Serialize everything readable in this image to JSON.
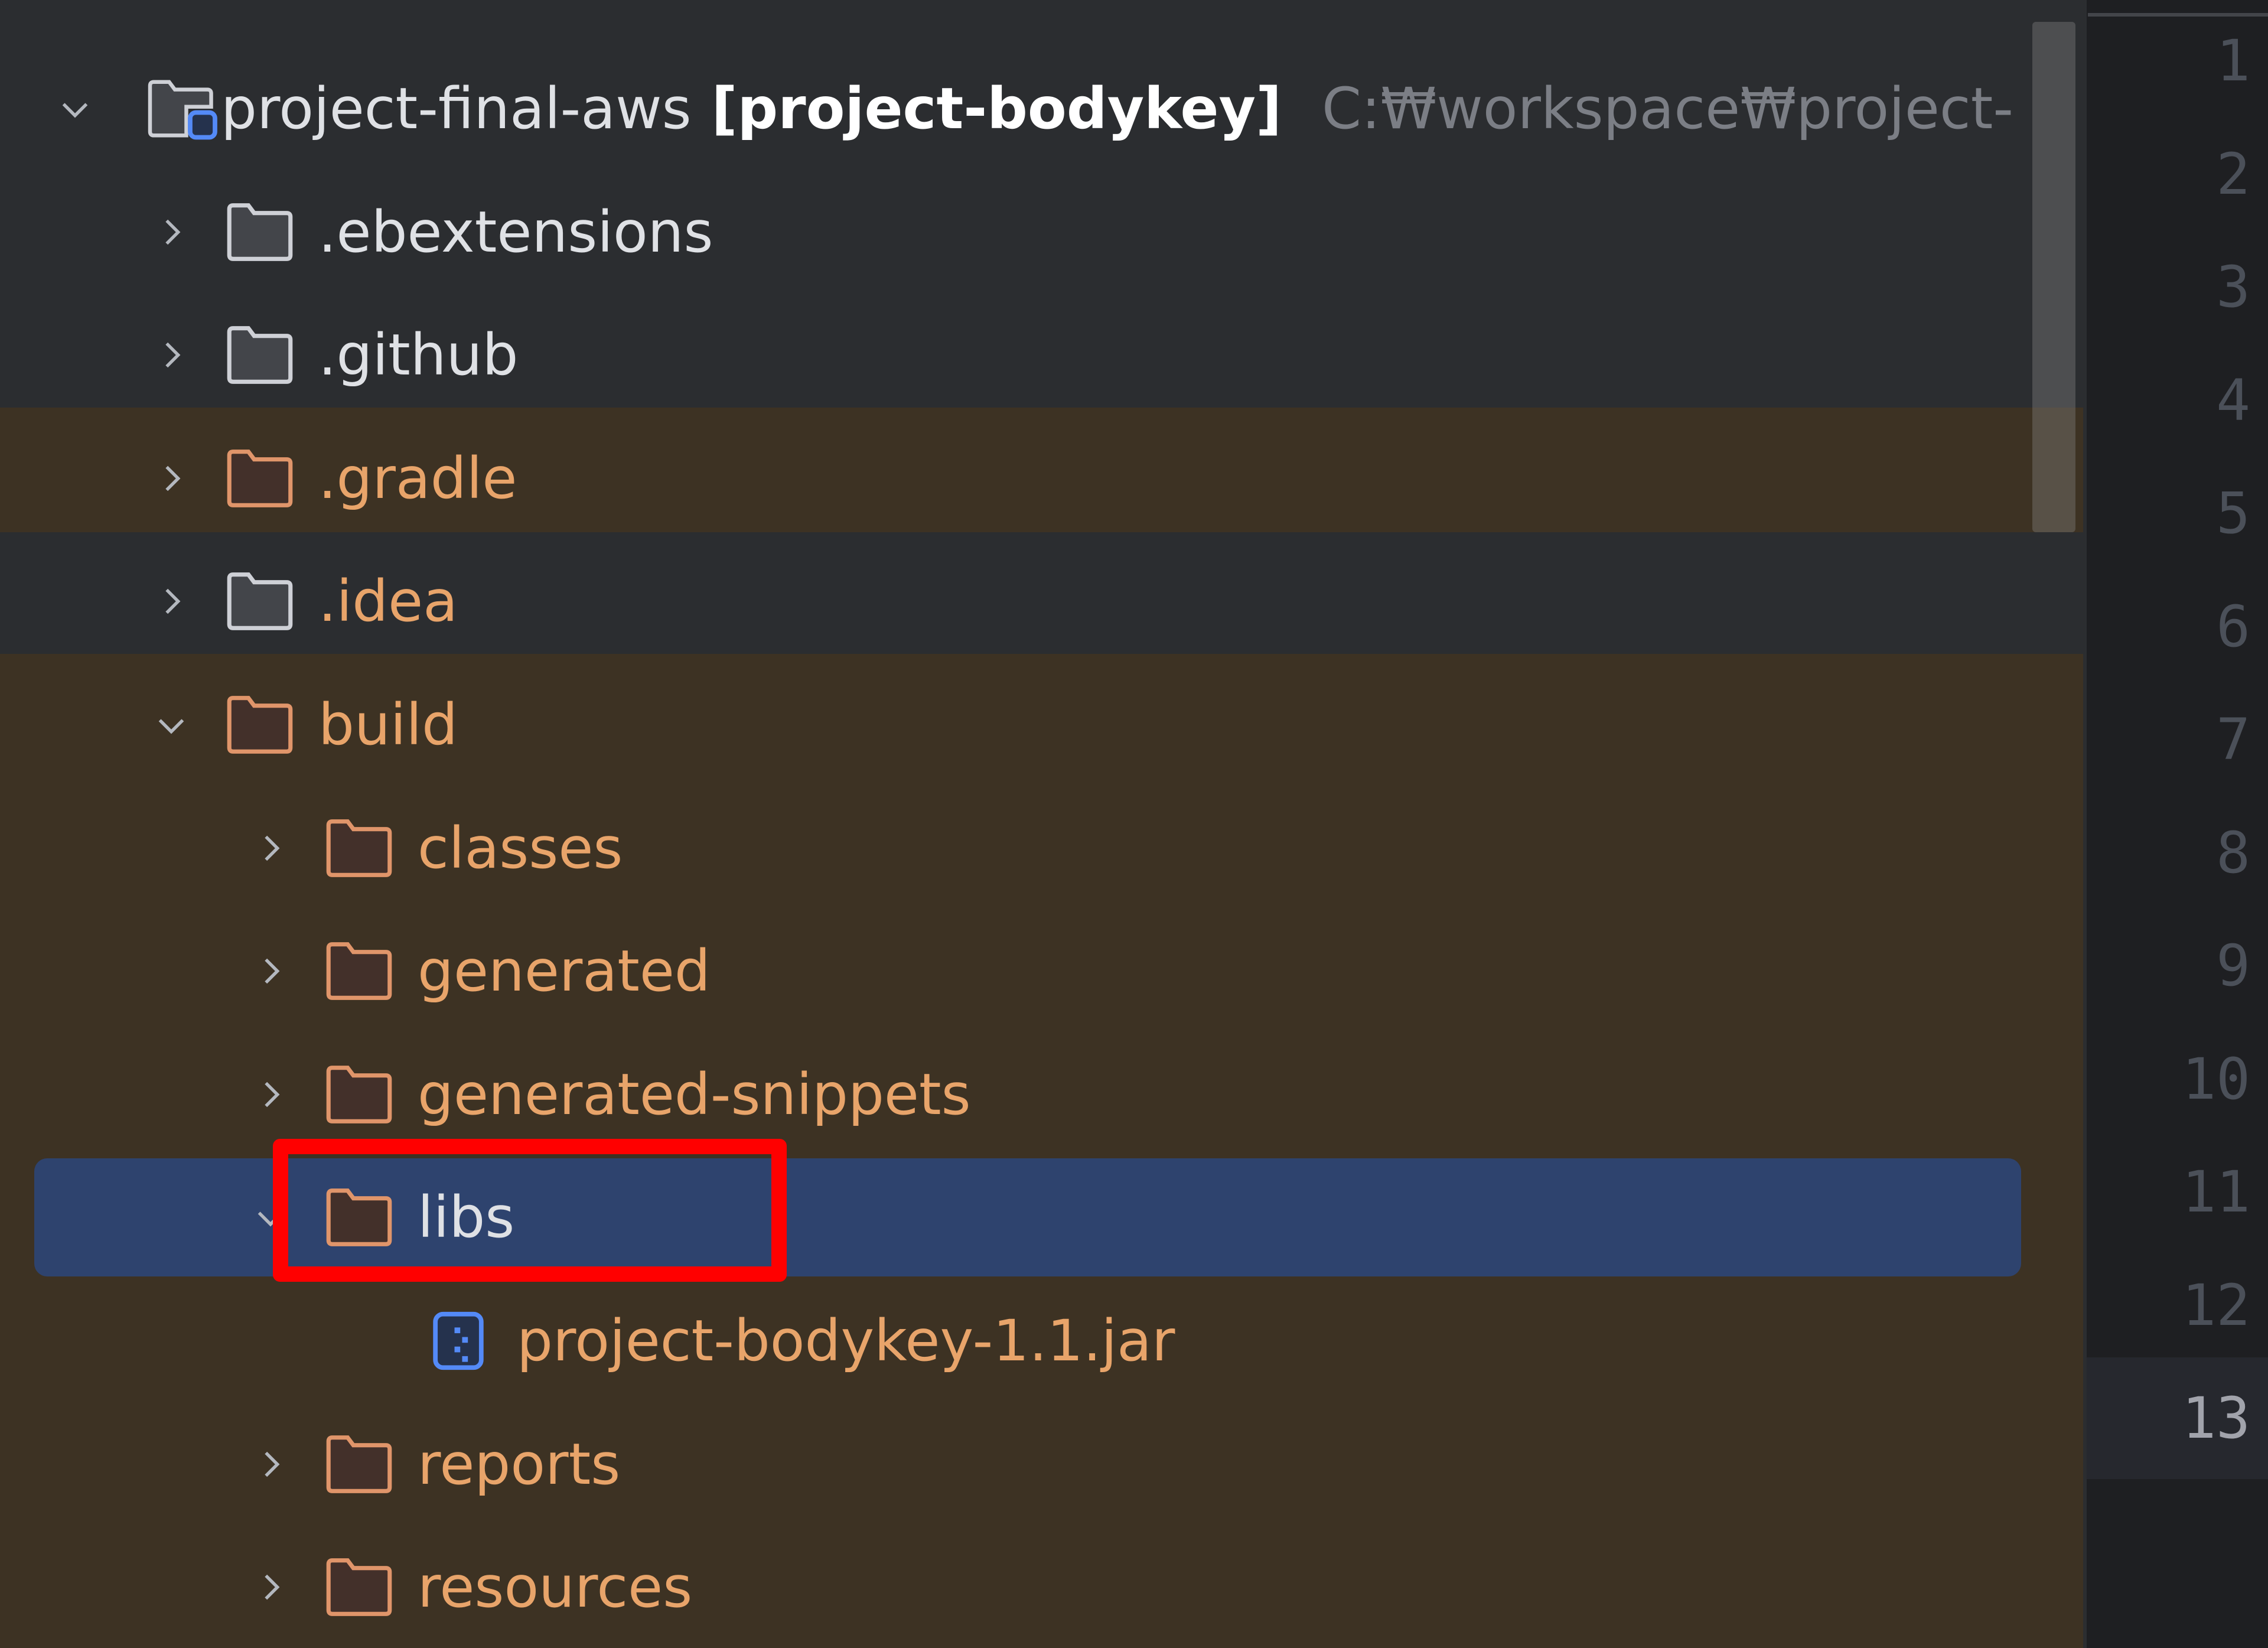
{
  "project_tree": {
    "root": {
      "name": "project-final-aws",
      "module": "[project-bodykey]",
      "path": "C:₩workspace₩project-",
      "expanded": true
    },
    "items": [
      {
        "label": ".ebextensions",
        "type": "folder",
        "depth": 1,
        "expanded": false,
        "excluded": false
      },
      {
        "label": ".github",
        "type": "folder",
        "depth": 1,
        "expanded": false,
        "excluded": false
      },
      {
        "label": ".gradle",
        "type": "folder",
        "depth": 1,
        "expanded": false,
        "excluded": true
      },
      {
        "label": ".idea",
        "type": "folder",
        "depth": 1,
        "expanded": false,
        "excluded": false,
        "ignored_text": true
      },
      {
        "label": "build",
        "type": "folder",
        "depth": 1,
        "expanded": true,
        "excluded": true
      },
      {
        "label": "classes",
        "type": "folder",
        "depth": 2,
        "expanded": false,
        "excluded": true
      },
      {
        "label": "generated",
        "type": "folder",
        "depth": 2,
        "expanded": false,
        "excluded": true
      },
      {
        "label": "generated-snippets",
        "type": "folder",
        "depth": 2,
        "expanded": false,
        "excluded": true
      },
      {
        "label": "libs",
        "type": "folder",
        "depth": 2,
        "expanded": true,
        "excluded": true,
        "selected": true
      },
      {
        "label": "project-bodykey-1.1.jar",
        "type": "jar",
        "depth": 3,
        "excluded": true
      },
      {
        "label": "reports",
        "type": "folder",
        "depth": 2,
        "expanded": false,
        "excluded": true
      },
      {
        "label": "resources",
        "type": "folder",
        "depth": 2,
        "expanded": false,
        "excluded": true
      }
    ]
  },
  "editor": {
    "line_numbers": [
      "1",
      "2",
      "3",
      "4",
      "5",
      "6",
      "7",
      "8",
      "9",
      "10",
      "11",
      "12",
      "13"
    ],
    "current_line": "13"
  },
  "annotation": {
    "highlighted_item": "libs",
    "color": "#ff0000"
  },
  "colors": {
    "panel_bg": "#2b2d30",
    "excluded_bg": "#3d3223",
    "selection_bg": "#2e436e",
    "excluded_text": "#e8a46a",
    "gutter_bg": "#1e1f22"
  }
}
